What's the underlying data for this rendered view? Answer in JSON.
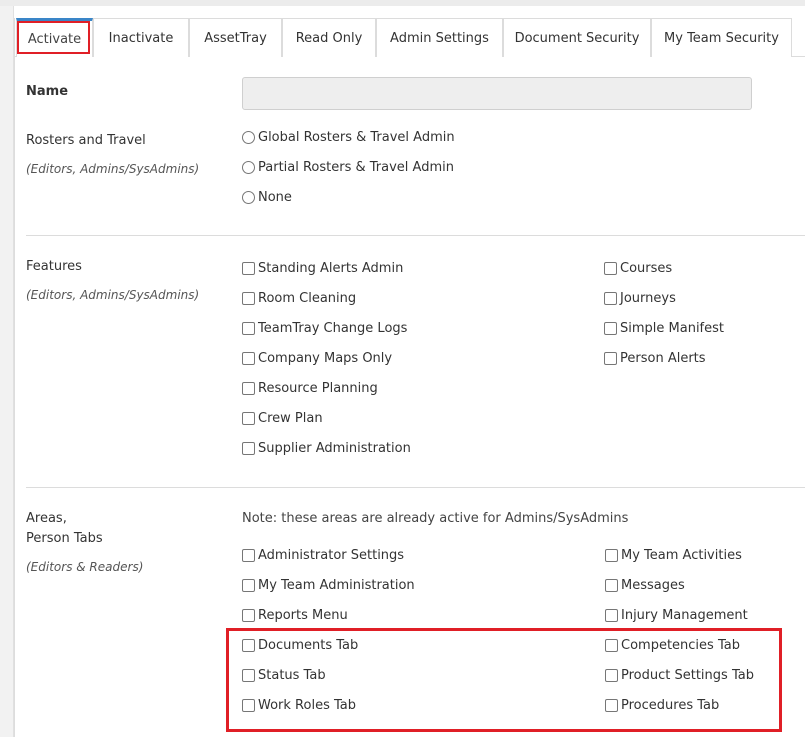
{
  "tabs": [
    "Activate",
    "Inactivate",
    "AssetTray",
    "Read Only",
    "Admin Settings",
    "Document Security",
    "My Team Security"
  ],
  "name": {
    "label": "Name",
    "value": ""
  },
  "rosters": {
    "label": "Rosters and Travel",
    "sublabel": "(Editors, Admins/SysAdmins)",
    "options": [
      "Global Rosters & Travel Admin",
      "Partial Rosters & Travel Admin",
      "None"
    ]
  },
  "features": {
    "label": "Features",
    "sublabel": "(Editors, Admins/SysAdmins)",
    "left": [
      "Standing Alerts Admin",
      "Room Cleaning",
      "TeamTray Change Logs",
      "Company Maps Only",
      "Resource Planning",
      "Crew Plan",
      "Supplier Administration"
    ],
    "right": [
      "Courses",
      "Journeys",
      "Simple Manifest",
      "Person Alerts"
    ]
  },
  "areas": {
    "label_line1": "Areas,",
    "label_line2": "Person Tabs",
    "sublabel": "(Editors & Readers)",
    "note": "Note: these areas are already active for Admins/SysAdmins",
    "left": [
      "Administrator Settings",
      "My Team Administration",
      "Reports Menu",
      "Documents Tab",
      "Status Tab",
      "Work Roles Tab"
    ],
    "right": [
      "My Team Activities",
      "Messages",
      "Injury Management",
      "Competencies Tab",
      "Product Settings Tab",
      "Procedures Tab"
    ]
  },
  "colors": {
    "highlight": "#e01f26",
    "active_tab": "#3a86c8"
  }
}
